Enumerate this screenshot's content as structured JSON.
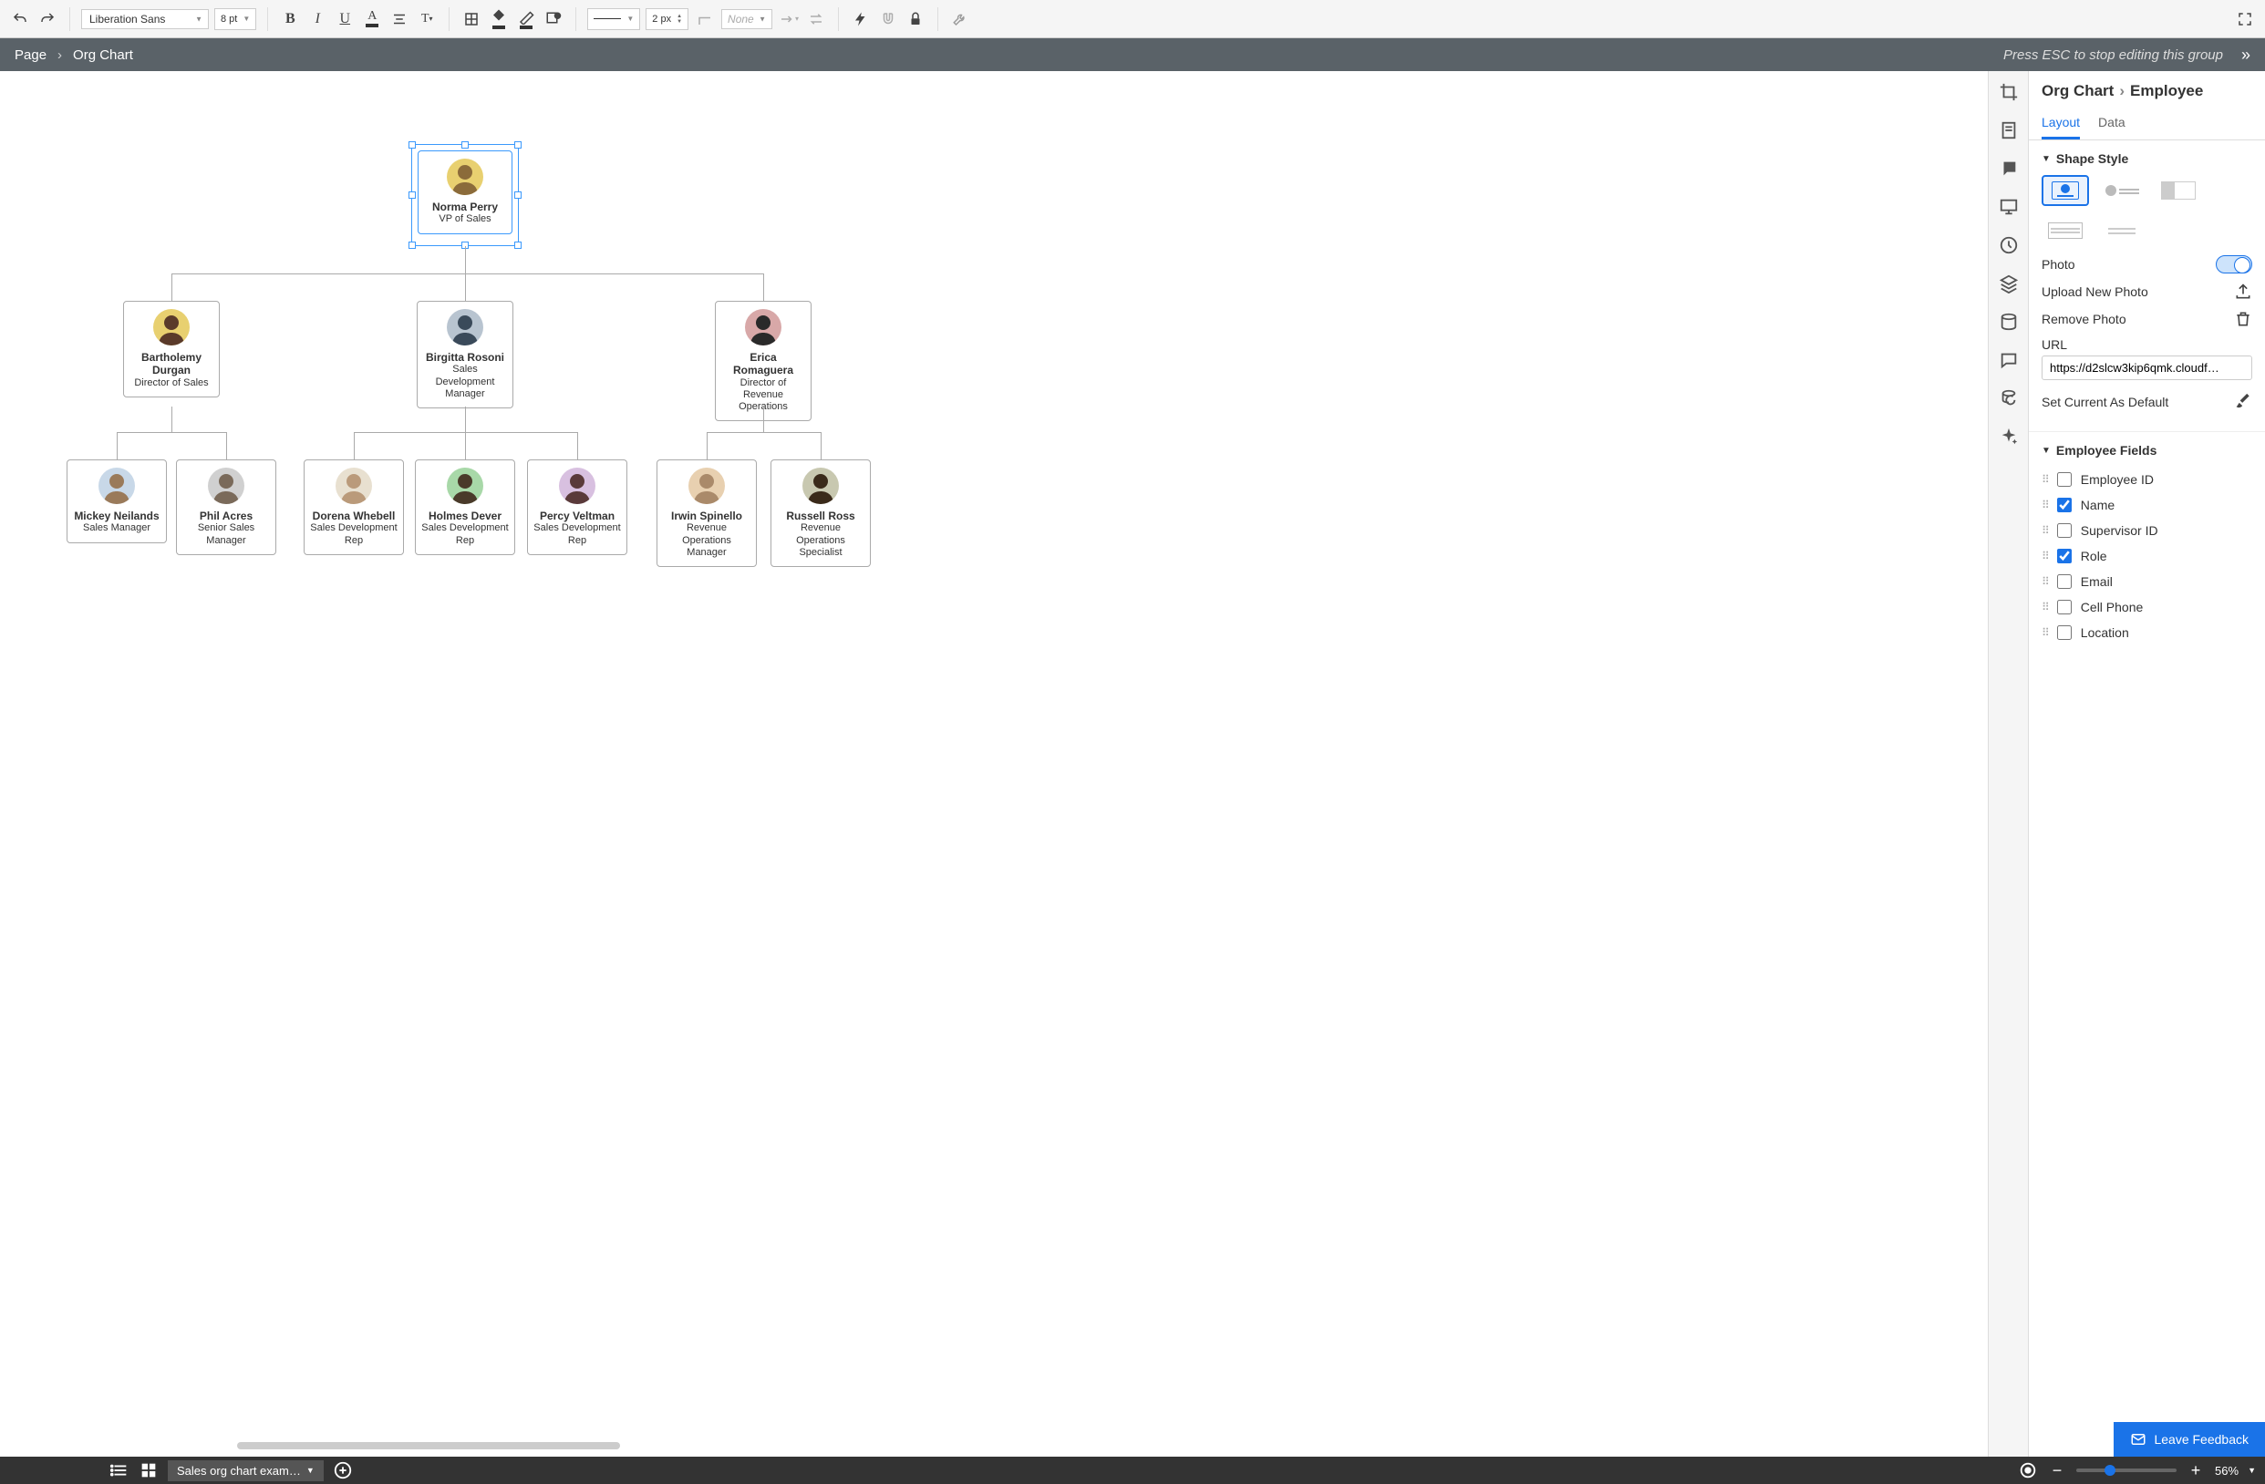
{
  "toolbar": {
    "font_family": "Liberation Sans",
    "font_size": "8 pt",
    "line_weight": "2 px",
    "arrow_style": "None"
  },
  "breadcrumb": {
    "root": "Page",
    "current": "Org Chart",
    "hint": "Press ESC to stop editing this group"
  },
  "right_panel": {
    "breadcrumb_root": "Org Chart",
    "breadcrumb_current": "Employee",
    "tabs": {
      "layout": "Layout",
      "data": "Data"
    },
    "shape_style_header": "Shape Style",
    "photo_label": "Photo",
    "photo_enabled": true,
    "upload_label": "Upload New Photo",
    "remove_label": "Remove Photo",
    "url_label": "URL",
    "url_value": "https://d2slcw3kip6qmk.cloudf…",
    "set_default_label": "Set Current As Default",
    "employee_fields_header": "Employee Fields",
    "fields": [
      {
        "label": "Employee ID",
        "checked": false
      },
      {
        "label": "Name",
        "checked": true
      },
      {
        "label": "Supervisor ID",
        "checked": false
      },
      {
        "label": "Role",
        "checked": true
      },
      {
        "label": "Email",
        "checked": false
      },
      {
        "label": "Cell Phone",
        "checked": false
      },
      {
        "label": "Location",
        "checked": false
      }
    ]
  },
  "org": {
    "root": {
      "name": "Norma Perry",
      "role": "VP of Sales",
      "avatar_bg": "#e8d070"
    },
    "managers": [
      {
        "name": "Bartholemy Durgan",
        "role": "Director of Sales",
        "avatar_bg": "#e8d070"
      },
      {
        "name": "Birgitta Rosoni",
        "role": "Sales Development Manager",
        "avatar_bg": "#b8c4d0"
      },
      {
        "name": "Erica Romaguera",
        "role": "Director of Revenue Operations",
        "avatar_bg": "#d8a8a8"
      }
    ],
    "reports": [
      {
        "name": "Mickey Neilands",
        "role": "Sales Manager",
        "avatar_bg": "#c8d8e8"
      },
      {
        "name": "Phil Acres",
        "role": "Senior Sales Manager",
        "avatar_bg": "#d0d0d0"
      },
      {
        "name": "Dorena Whebell",
        "role": "Sales Development Rep",
        "avatar_bg": "#e8e0d0"
      },
      {
        "name": "Holmes Dever",
        "role": "Sales Development Rep",
        "avatar_bg": "#a8d8a8"
      },
      {
        "name": "Percy Veltman",
        "role": "Sales Development Rep",
        "avatar_bg": "#d8c0e0"
      },
      {
        "name": "Irwin Spinello",
        "role": "Revenue Operations Manager",
        "avatar_bg": "#e8d0b0"
      },
      {
        "name": "Russell Ross",
        "role": "Revenue Operations Specialist",
        "avatar_bg": "#c8c8b0"
      }
    ]
  },
  "feedback_label": "Leave Feedback",
  "bottom": {
    "tab_label": "Sales org chart exam…",
    "zoom": "56%"
  }
}
